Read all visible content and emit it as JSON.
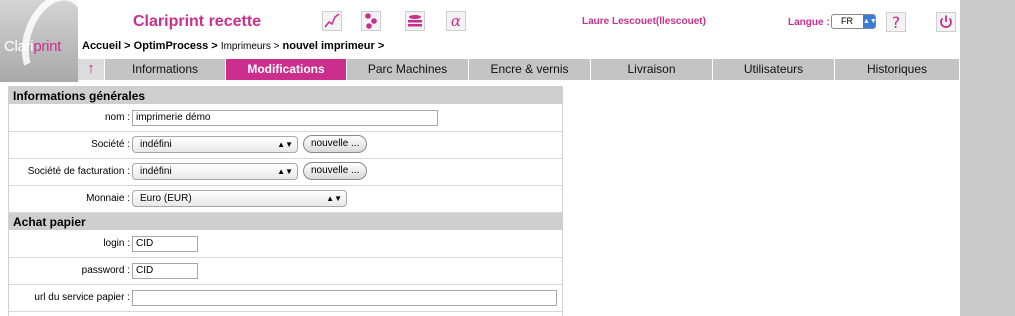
{
  "logo": {
    "text_a": "Clari",
    "text_b": "print"
  },
  "header": {
    "app_title": "Clariprint recette",
    "icons": [
      "chart-icon",
      "hierarchy-icon",
      "printer-stack-icon",
      "alpha-icon"
    ],
    "user": "Laure Lescouet(llescouet)",
    "lang_label": "Langue :",
    "lang_value": "FR",
    "help_glyph": "?",
    "power_glyph": "⏻"
  },
  "breadcrumb": {
    "accueil": "Accueil >",
    "optim": "OptimProcess >",
    "imprimeurs": "Imprimeurs >",
    "current": "nouvel imprimeur >"
  },
  "tabs": {
    "up": "↑",
    "items": [
      {
        "label": "Informations"
      },
      {
        "label": "Modifications"
      },
      {
        "label": "Parc Machines"
      },
      {
        "label": "Encre & vernis"
      },
      {
        "label": "Livraison"
      },
      {
        "label": "Utilisateurs"
      },
      {
        "label": "Historiques"
      }
    ]
  },
  "form": {
    "section_general": "Informations générales",
    "nom_label": "nom :",
    "nom_value": "imprimerie démo",
    "societe_label": "Société :",
    "societe_value": "indéfini",
    "societe_btn": "nouvelle ...",
    "societe_fact_label": "Société de facturation :",
    "societe_fact_value": "indéfini",
    "societe_fact_btn": "nouvelle ...",
    "monnaie_label": "Monnaie :",
    "monnaie_value": "Euro (EUR)",
    "section_papier": "Achat papier",
    "login_label": "login :",
    "login_value": "CID",
    "password_label": "password :",
    "password_value": "CID",
    "url_label": "url du service papier :",
    "url_value": ""
  },
  "colors": {
    "accent": "#cc2e8d",
    "tab_bg": "#c4c4c4",
    "background": "#c9c9c9"
  }
}
